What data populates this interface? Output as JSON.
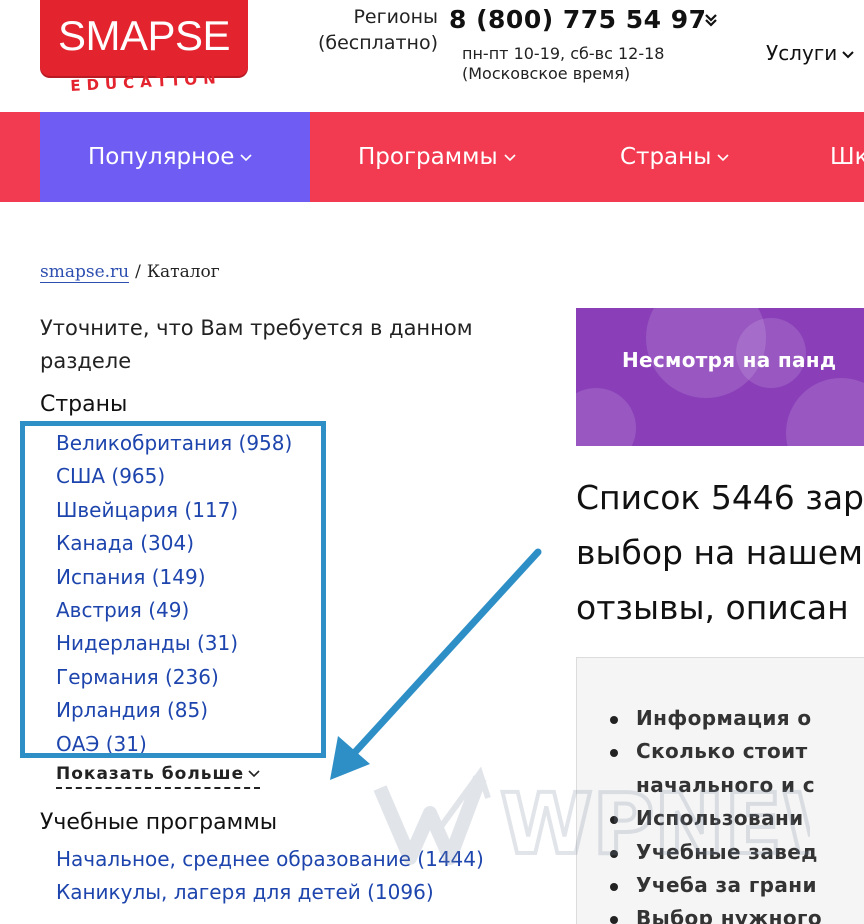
{
  "header": {
    "logo_word": "SMAPSE",
    "logo_sub": "EDUCATION",
    "regions_line1": "Регионы",
    "regions_line2": "(бесплатно)",
    "phone": "8 (800) 775 54 97",
    "hours_line1": "пн-пт 10-19, сб-вс 12-18",
    "hours_line2": "(Московское время)",
    "services_label": "Услуги"
  },
  "nav": {
    "items": [
      {
        "label": "Популярное",
        "active": true
      },
      {
        "label": "Программы",
        "active": false
      },
      {
        "label": "Страны",
        "active": false
      },
      {
        "label": "Шк",
        "active": false
      }
    ]
  },
  "breadcrumb": {
    "home": "smapse.ru",
    "separator": "/",
    "current": "Каталог"
  },
  "filters": {
    "intro": "Уточните, что Вам требуется в данном разделе",
    "countries_title": "Страны",
    "countries": [
      "Великобритания (958)",
      "США (965)",
      "Швейцария (117)",
      "Канада (304)",
      "Испания (149)",
      "Австрия (49)",
      "Нидерланды (31)",
      "Германия (236)",
      "Ирландия (85)",
      "ОАЭ (31)"
    ],
    "show_more": "Показать больше",
    "programs_title": "Учебные программы",
    "programs": [
      "Начальное, среднее образование (1444)",
      "Каникулы, лагеря для детей (1096)"
    ]
  },
  "main": {
    "promo_text": "Несмотря на панд",
    "headline_lines": [
      "Список 5446 зар",
      "выбор на нашем",
      "отзывы, описан"
    ],
    "bullets": [
      "Информация о",
      "Сколько стоит",
      "начального и с",
      "Использовани",
      "Учебные завед",
      "Учеба за грани",
      "Выбор нужного"
    ]
  },
  "watermark": "WPNEW",
  "colors": {
    "brand_red": "#e3232d",
    "nav_red": "#f23b51",
    "nav_active": "#6f5cf2",
    "link_blue": "#1d45ad",
    "annotation_blue": "#2e8fc7",
    "promo_purple": "#8a3fb8"
  }
}
